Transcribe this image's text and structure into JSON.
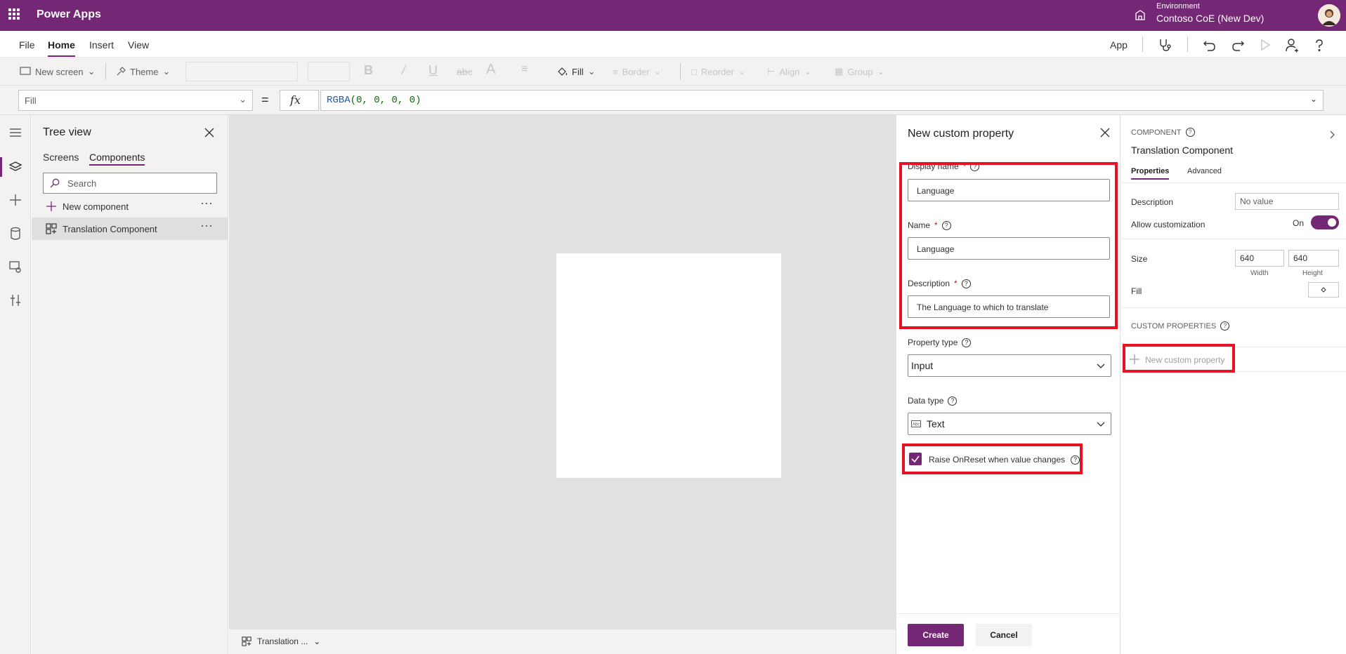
{
  "topbar": {
    "app_title": "Power Apps",
    "environment_label": "Environment",
    "environment_name": "Contoso CoE (New Dev)"
  },
  "menubar": {
    "items": [
      "File",
      "Home",
      "Insert",
      "View"
    ],
    "active": "Home",
    "app_label": "App"
  },
  "commandbar": {
    "new_screen": "New screen",
    "theme": "Theme",
    "fill": "Fill",
    "border": "Border",
    "reorder": "Reorder",
    "align": "Align",
    "group": "Group"
  },
  "formulabar": {
    "property": "Fill",
    "equals": "=",
    "fx": "fx",
    "formula_fn": "RGBA",
    "formula_args": "(0, 0, 0, 0)"
  },
  "treeview": {
    "title": "Tree view",
    "tabs": [
      "Screens",
      "Components"
    ],
    "active_tab": "Components",
    "search_placeholder": "Search",
    "new_component": "New component",
    "items": [
      {
        "label": "Translation Component",
        "selected": true
      }
    ]
  },
  "canvas": {
    "bottom_component": "Translation ..."
  },
  "new_custom_property": {
    "title": "New custom property",
    "display_name_label": "Display name",
    "display_name_value": "Language",
    "name_label": "Name",
    "name_value": "Language",
    "description_label": "Description",
    "description_value": "The Language to which to translate",
    "property_type_label": "Property type",
    "property_type_value": "Input",
    "data_type_label": "Data type",
    "data_type_value": "Text",
    "raise_onreset_label": "Raise OnReset when value changes",
    "raise_onreset_checked": true,
    "create_label": "Create",
    "cancel_label": "Cancel"
  },
  "properties_panel": {
    "kind": "COMPONENT",
    "name": "Translation Component",
    "tabs": [
      "Properties",
      "Advanced"
    ],
    "active_tab": "Properties",
    "description_label": "Description",
    "description_placeholder": "No value",
    "allow_customization_label": "Allow customization",
    "allow_customization_state": "On",
    "size_label": "Size",
    "width_value": "640",
    "height_value": "640",
    "width_sub": "Width",
    "height_sub": "Height",
    "fill_label": "Fill",
    "custom_properties_title": "CUSTOM PROPERTIES",
    "new_custom_property": "New custom property"
  },
  "colors": {
    "brand": "#742774",
    "highlight": "#e81123",
    "canvas_bg": "#e1e1e1"
  }
}
